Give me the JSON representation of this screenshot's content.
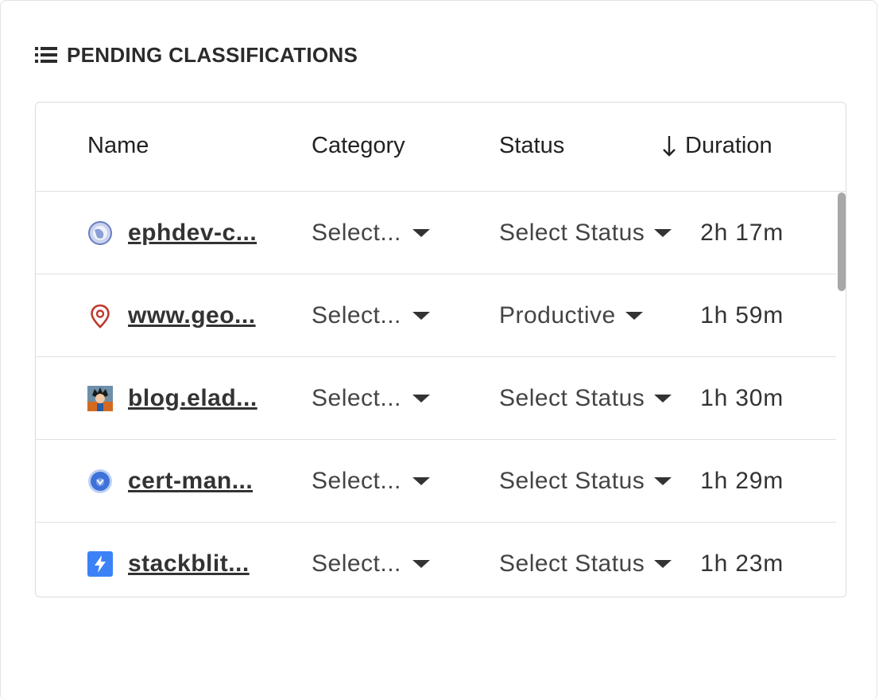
{
  "panel": {
    "title": "PENDING CLASSIFICATIONS",
    "icon": "list-icon"
  },
  "table": {
    "columns": {
      "name": "Name",
      "category": "Category",
      "status": "Status",
      "duration": "Duration",
      "sort_icon": "arrow-down-icon"
    },
    "rows": [
      {
        "name": "ephdev-c...",
        "favicon": "globe-icon",
        "category": "Select...",
        "status": "Select Status",
        "duration": "2h 17m"
      },
      {
        "name": "www.geo...",
        "favicon": "map-pin-icon",
        "category": "Select...",
        "status": "Productive",
        "duration": "1h 59m"
      },
      {
        "name": "blog.elad...",
        "favicon": "avatar-icon",
        "category": "Select...",
        "status": "Select Status",
        "duration": "1h 30m"
      },
      {
        "name": "cert-man...",
        "favicon": "blue-circle-icon",
        "category": "Select...",
        "status": "Select Status",
        "duration": "1h 29m"
      },
      {
        "name": "stackblit...",
        "favicon": "lightning-icon",
        "category": "Select...",
        "status": "Select Status",
        "duration": "1h 23m"
      }
    ]
  },
  "colors": {
    "brand_blue": "#3b82f6",
    "pin_red": "#c0392b",
    "text": "#333333"
  }
}
